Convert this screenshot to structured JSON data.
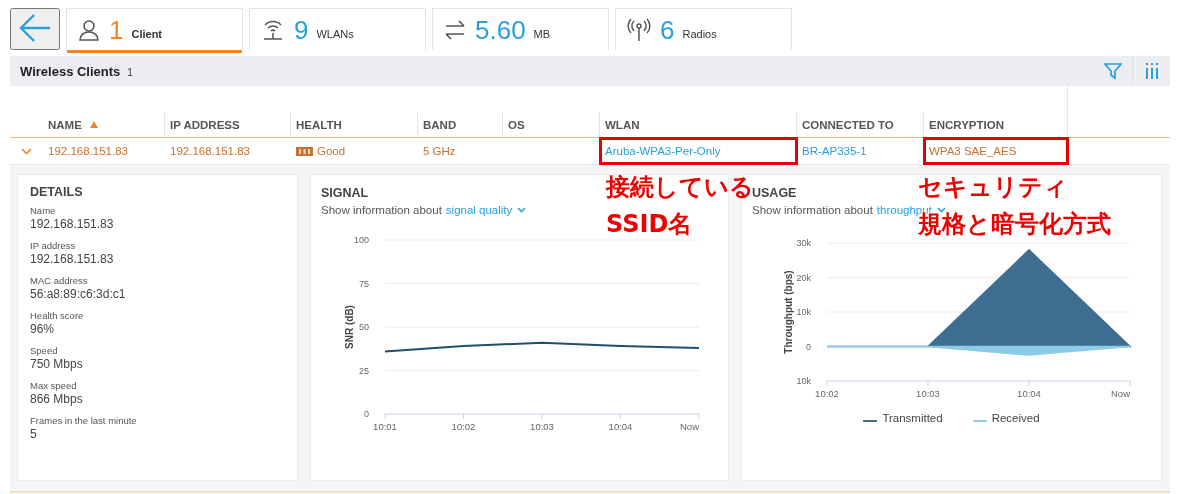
{
  "tabs": [
    {
      "count": "1",
      "label": "Client",
      "selected": true
    },
    {
      "count": "9",
      "label": "WLANs",
      "selected": false
    },
    {
      "count": "5.60",
      "label": "MB",
      "selected": false
    },
    {
      "count": "6",
      "label": "Radios",
      "selected": false
    }
  ],
  "section": {
    "title": "Wireless Clients",
    "count": "1"
  },
  "table": {
    "columns": [
      {
        "label": "NAME",
        "sorted": true
      },
      {
        "label": "IP ADDRESS",
        "sorted": false
      },
      {
        "label": "HEALTH",
        "sorted": false
      },
      {
        "label": "BAND",
        "sorted": false
      },
      {
        "label": "OS",
        "sorted": false
      },
      {
        "label": "WLAN",
        "sorted": false
      },
      {
        "label": "CONNECTED TO",
        "sorted": false
      },
      {
        "label": "ENCRYPTION",
        "sorted": false
      }
    ],
    "rows": [
      {
        "expanded": true,
        "cells": [
          {
            "kind": "text",
            "text": "192.168.151.83",
            "highlighted": false
          },
          {
            "kind": "text",
            "text": "192.168.151.83",
            "highlighted": false
          },
          {
            "kind": "health",
            "text": "Good",
            "highlighted": false
          },
          {
            "kind": "text",
            "text": "5 GHz",
            "highlighted": false
          },
          null,
          {
            "kind": "link",
            "text": "Aruba-WPA3-Per-Only",
            "highlighted": true
          },
          {
            "kind": "link",
            "text": "BR-AP335-1",
            "highlighted": false
          },
          {
            "kind": "text",
            "text": "WPA3 SAE_AES",
            "highlighted": true
          }
        ]
      }
    ]
  },
  "details": {
    "title": "DETAILS",
    "fields": [
      {
        "label": "Name",
        "value": "192.168.151.83"
      },
      {
        "label": "IP address",
        "value": "192.168.151.83"
      },
      {
        "label": "MAC address",
        "value": "56:a8:89:c6:3d:c1"
      },
      {
        "label": "Health score",
        "value": "96%"
      },
      {
        "label": "Speed",
        "value": "750 Mbps"
      },
      {
        "label": "Max speed",
        "value": "866 Mbps"
      },
      {
        "label": "Frames in the last minute",
        "value": "5"
      }
    ]
  },
  "signal": {
    "title": "SIGNAL",
    "prompt": "Show information about",
    "selector": "signal quality",
    "chart_data": {
      "type": "line",
      "ylabel": "SNR (dB)",
      "categories": [
        "10:01",
        "10:02",
        "10:03",
        "10:04",
        "Now"
      ],
      "ylim": [
        0,
        100
      ],
      "yticks": [
        0,
        25,
        50,
        75,
        100
      ],
      "grid": true,
      "values": [
        36,
        39,
        41,
        39,
        38
      ]
    }
  },
  "usage": {
    "title": "USAGE",
    "prompt": "Show information about",
    "selector": "throughput",
    "chart_data": {
      "type": "area",
      "ylabel": "Throughput (bps)",
      "categories": [
        "10:02",
        "10:03",
        "10:04",
        "Now"
      ],
      "ylim": [
        -10000,
        30000
      ],
      "grid": true,
      "yticks": [
        {
          "value": -10000,
          "label": "10k"
        },
        0,
        {
          "value": 10000,
          "label": "10k"
        },
        {
          "value": 20000,
          "label": "20k"
        },
        {
          "value": 30000,
          "label": "30k"
        }
      ],
      "series": [
        {
          "name": "Transmitted",
          "color": "#3d6e91",
          "values": [
            0,
            0,
            28000,
            0
          ]
        },
        {
          "name": "Received",
          "color": "#8ecbea",
          "values": [
            0,
            0,
            -2500,
            0
          ]
        }
      ]
    }
  },
  "annotations": [
    {
      "lines": [
        "接続している",
        "SSID名"
      ]
    },
    {
      "lines": [
        "セキュリティ",
        "規格と暗号化方式"
      ]
    }
  ]
}
